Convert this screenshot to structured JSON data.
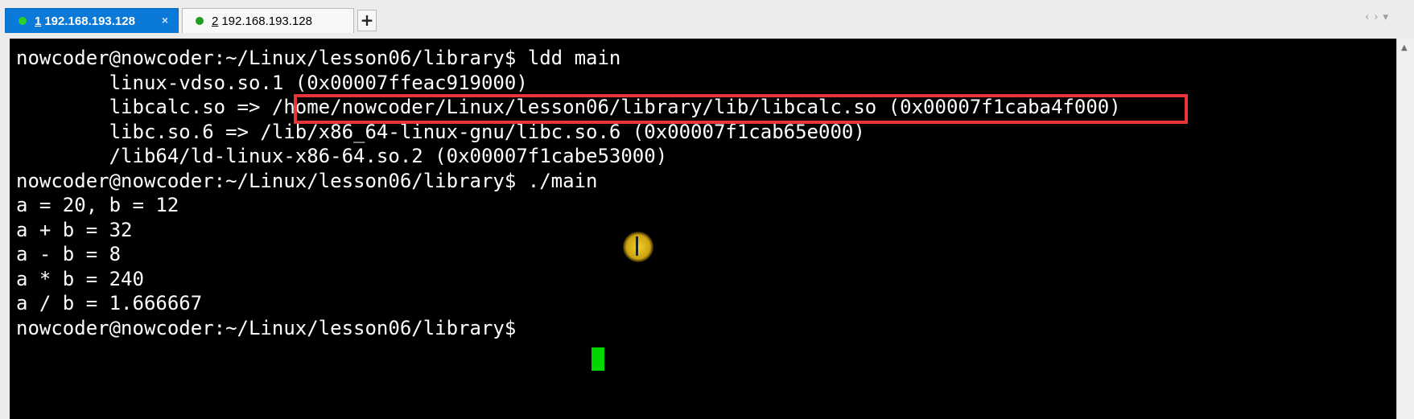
{
  "tabs": [
    {
      "number": "1",
      "title": "192.168.193.128",
      "close": "×",
      "status_color": "#2bd12b",
      "active": true
    },
    {
      "number": "2",
      "title": "192.168.193.128",
      "status_color": "#1f9a1f",
      "active": false
    }
  ],
  "add_tab": "+",
  "nav": {
    "prev": "‹",
    "next": "›",
    "menu": "▾"
  },
  "terminal": {
    "lines": [
      "nowcoder@nowcoder:~/Linux/lesson06/library$ ldd main",
      "        linux-vdso.so.1 (0x00007ffeac919000)",
      "        libcalc.so => /home/nowcoder/Linux/lesson06/library/lib/libcalc.so (0x00007f1caba4f000)",
      "        libc.so.6 => /lib/x86_64-linux-gnu/libc.so.6 (0x00007f1cab65e000)",
      "        /lib64/ld-linux-x86-64.so.2 (0x00007f1cabe53000)",
      "nowcoder@nowcoder:~/Linux/lesson06/library$ ./main",
      "a = 20, b = 12",
      "a + b = 32",
      "a - b = 8",
      "a * b = 240",
      "a / b = 1.666667",
      "nowcoder@nowcoder:~/Linux/lesson06/library$ "
    ],
    "highlight_color": "#e8353a",
    "cursor_color": "#00d800",
    "background": "#000000",
    "foreground": "#ffffff"
  },
  "scrollbar": {
    "up_arrow": "▲"
  }
}
